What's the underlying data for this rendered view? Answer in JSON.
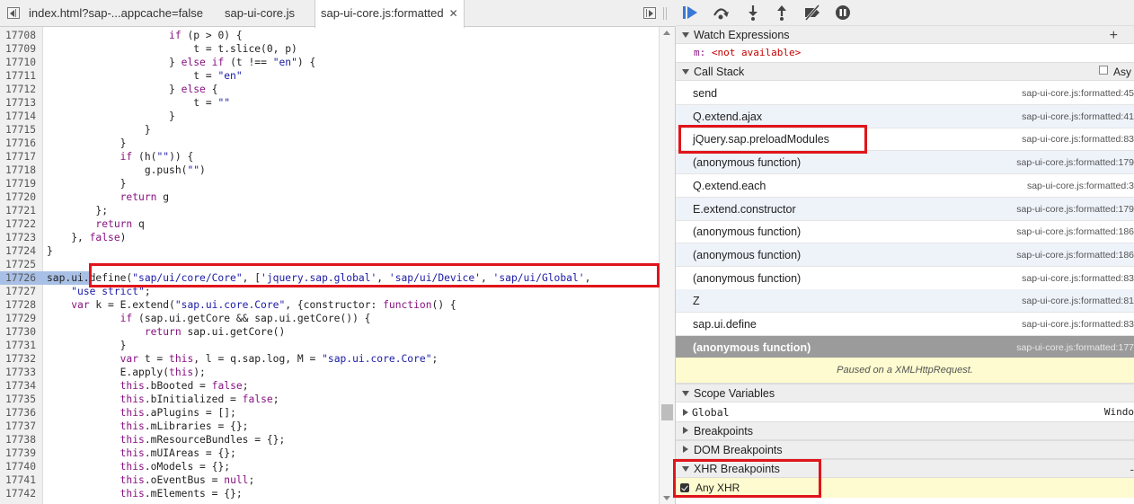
{
  "tabs": [
    {
      "label": "index.html?sap-...appcache=false",
      "active": false
    },
    {
      "label": "sap-ui-core.js",
      "active": false
    },
    {
      "label": "sap-ui-core.js:formatted",
      "active": true,
      "close": "✕"
    }
  ],
  "code_lines": [
    {
      "n": "17708",
      "code": "                    if (p > 0) {"
    },
    {
      "n": "17709",
      "code": "                        t = t.slice(0, p)"
    },
    {
      "n": "17710",
      "code": "                    } else if (t !== \"en\") {"
    },
    {
      "n": "17711",
      "code": "                        t = \"en\""
    },
    {
      "n": "17712",
      "code": "                    } else {"
    },
    {
      "n": "17713",
      "code": "                        t = \"\""
    },
    {
      "n": "17714",
      "code": "                    }"
    },
    {
      "n": "17715",
      "code": "                }"
    },
    {
      "n": "17716",
      "code": "            }"
    },
    {
      "n": "17717",
      "code": "            if (h(\"\")) {"
    },
    {
      "n": "17718",
      "code": "                g.push(\"\")"
    },
    {
      "n": "17719",
      "code": "            }"
    },
    {
      "n": "17720",
      "code": "            return g"
    },
    {
      "n": "17721",
      "code": "        };"
    },
    {
      "n": "17722",
      "code": "        return q"
    },
    {
      "n": "17723",
      "code": "    }, false)"
    },
    {
      "n": "17724",
      "code": "}"
    },
    {
      "n": "17725",
      "code": ""
    },
    {
      "n": "17726",
      "code": "sap.ui.define(\"sap/ui/core/Core\", ['jquery.sap.global', 'sap/ui/Device', 'sap/ui/Global',",
      "highlighted": true
    },
    {
      "n": "17727",
      "code": "    \"use strict\";"
    },
    {
      "n": "17728",
      "code": "    var k = E.extend(\"sap.ui.core.Core\", {constructor: function() {"
    },
    {
      "n": "17729",
      "code": "            if (sap.ui.getCore && sap.ui.getCore()) {"
    },
    {
      "n": "17730",
      "code": "                return sap.ui.getCore()"
    },
    {
      "n": "17731",
      "code": "            }"
    },
    {
      "n": "17732",
      "code": "            var t = this, l = q.sap.log, M = \"sap.ui.core.Core\";"
    },
    {
      "n": "17733",
      "code": "            E.apply(this);"
    },
    {
      "n": "17734",
      "code": "            this.bBooted = false;"
    },
    {
      "n": "17735",
      "code": "            this.bInitialized = false;"
    },
    {
      "n": "17736",
      "code": "            this.aPlugins = [];"
    },
    {
      "n": "17737",
      "code": "            this.mLibraries = {};"
    },
    {
      "n": "17738",
      "code": "            this.mResourceBundles = {};"
    },
    {
      "n": "17739",
      "code": "            this.mUIAreas = {};"
    },
    {
      "n": "17740",
      "code": "            this.oModels = {};"
    },
    {
      "n": "17741",
      "code": "            this.oEventBus = null;"
    },
    {
      "n": "17742",
      "code": "            this.mElements = {};"
    }
  ],
  "sidebar": {
    "watch": {
      "title": "Watch Expressions",
      "add": "+",
      "name": "m:",
      "value": "<not available>"
    },
    "callstack": {
      "title": "Call Stack",
      "async_label": "Asy",
      "frames": [
        {
          "name": "send",
          "loc": "sap-ui-core.js:formatted:45"
        },
        {
          "name": "Q.extend.ajax",
          "loc": "sap-ui-core.js:formatted:41"
        },
        {
          "name": "jQuery.sap.preloadModules",
          "loc": "sap-ui-core.js:formatted:83"
        },
        {
          "name": "(anonymous function)",
          "loc": "sap-ui-core.js:formatted:179"
        },
        {
          "name": "Q.extend.each",
          "loc": "sap-ui-core.js:formatted:3"
        },
        {
          "name": "E.extend.constructor",
          "loc": "sap-ui-core.js:formatted:179"
        },
        {
          "name": "(anonymous function)",
          "loc": "sap-ui-core.js:formatted:186"
        },
        {
          "name": "(anonymous function)",
          "loc": "sap-ui-core.js:formatted:186"
        },
        {
          "name": "(anonymous function)",
          "loc": "sap-ui-core.js:formatted:83"
        },
        {
          "name": "Z",
          "loc": "sap-ui-core.js:formatted:81"
        },
        {
          "name": "sap.ui.define",
          "loc": "sap-ui-core.js:formatted:83"
        },
        {
          "name": "(anonymous function)",
          "loc": "sap-ui-core.js:formatted:177",
          "selected": true
        }
      ],
      "paused_message": "Paused on a XMLHttpRequest."
    },
    "scope": {
      "title": "Scope Variables",
      "global_label": "Global",
      "global_value": "Windo"
    },
    "breakpoints_title": "Breakpoints",
    "dom_breakpoints_title": "DOM Breakpoints",
    "xhr": {
      "title": "XHR Breakpoints",
      "minus": "-",
      "item": "Any XHR"
    }
  },
  "colors": {
    "highlight": "#a9c0e6",
    "annotation": "#e0151b",
    "paused_bg": "#fdfbcf",
    "resume_icon": "#3a78d6"
  }
}
